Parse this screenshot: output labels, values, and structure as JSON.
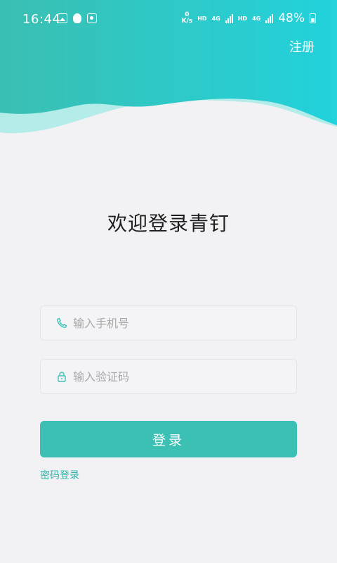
{
  "status_bar": {
    "time": "16:44",
    "net_speed_value": "0",
    "net_speed_unit": "K/s",
    "hd1": "HD",
    "net1": "4G",
    "hd2": "HD",
    "net2": "4G",
    "battery": "48%"
  },
  "header": {
    "register_label": "注册"
  },
  "welcome_title": "欢迎登录青钉",
  "form": {
    "phone_placeholder": "输入手机号",
    "code_placeholder": "输入验证码",
    "login_label": "登录",
    "password_login_label": "密码登录"
  },
  "colors": {
    "accent": "#3cc0b4",
    "header_gradient_start": "#3bbfb2",
    "header_gradient_end": "#22d2dc",
    "wave_light": "#b3ece8"
  }
}
